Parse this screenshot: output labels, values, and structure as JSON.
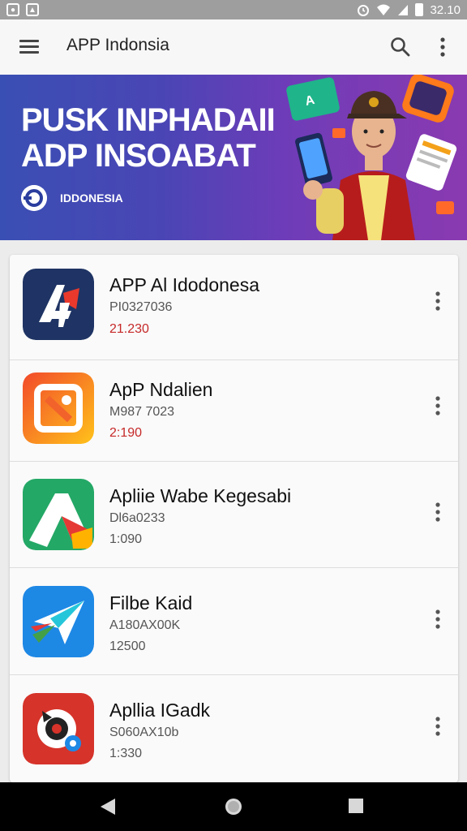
{
  "statusbar": {
    "time": "32.10",
    "left_icons": [
      "notification-icon",
      "photo-icon"
    ],
    "right_icons": [
      "alarm-icon",
      "wifi-icon",
      "signal-icon",
      "battery-icon"
    ]
  },
  "appbar": {
    "title": "APP Indonsia",
    "icons": [
      "menu-icon",
      "search-icon",
      "more-vert-icon"
    ]
  },
  "banner": {
    "line1": "PUSK INPHADAII",
    "line2": "ADP INSOABAT",
    "badge": "IDDONESIA"
  },
  "apps": [
    {
      "name": "APP Al Idodonesa",
      "sub": "PI0327036",
      "size": "21.230",
      "size_color": "#c62828",
      "icon": "app-ai-icon"
    },
    {
      "name": "ApP Ndalien",
      "sub": "M987 7023",
      "size": "2:190",
      "size_color": "#c62828",
      "icon": "app-ndalien-icon"
    },
    {
      "name": "Apliie Wabe Kegesabi",
      "sub": "Dl6a0233",
      "size": "1:090",
      "size_color": "#555555",
      "icon": "app-wabe-icon"
    },
    {
      "name": "Filbe Kaid",
      "sub": "A180AX00K",
      "size": "12500",
      "size_color": "#555555",
      "icon": "app-filbe-icon"
    },
    {
      "name": "Apllia IGadk",
      "sub": "S060AX10b",
      "size": "1:330",
      "size_color": "#555555",
      "icon": "app-igadk-icon"
    }
  ],
  "navbar": {
    "buttons": [
      "back-icon",
      "home-icon",
      "recents-icon"
    ]
  },
  "colors": {
    "banner_start": "#3a4fb3",
    "banner_end": "#8a3ab0",
    "accent_red": "#c62828"
  }
}
